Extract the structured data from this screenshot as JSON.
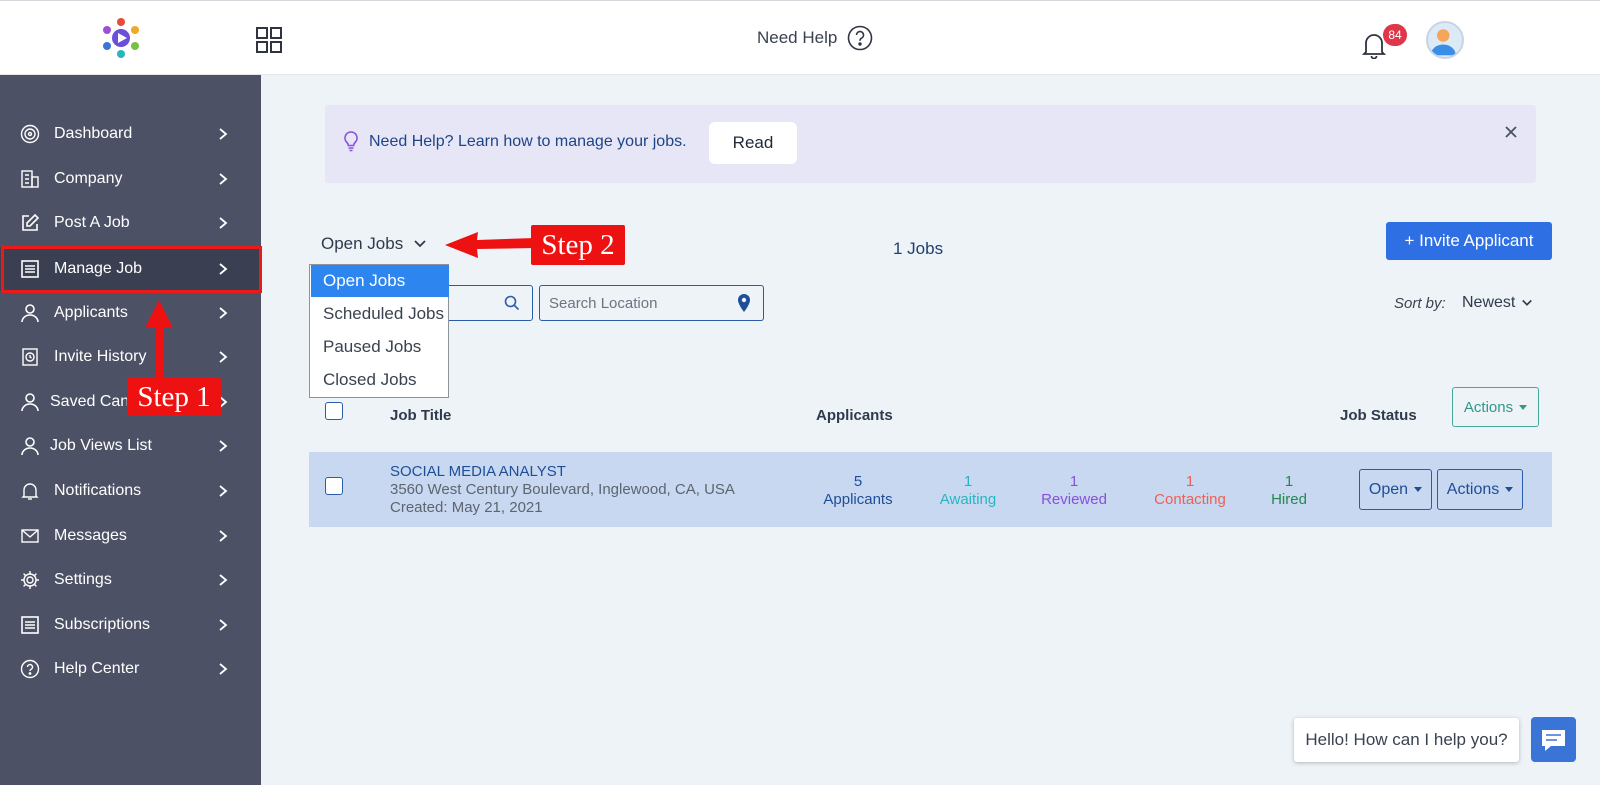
{
  "header": {
    "need_help": "Need Help",
    "notification_count": "84",
    "icons": [
      "logo-icon",
      "apps-grid-icon",
      "help-circle-icon",
      "bell-icon",
      "user-avatar-icon"
    ]
  },
  "sidebar": {
    "items": [
      {
        "label": "Dashboard",
        "icon": "target-icon"
      },
      {
        "label": "Company",
        "icon": "building-icon"
      },
      {
        "label": "Post A Job",
        "icon": "edit-icon"
      },
      {
        "label": "Manage Job",
        "icon": "list-icon"
      },
      {
        "label": "Applicants",
        "icon": "user-icon"
      },
      {
        "label": "Invite History",
        "icon": "history-icon"
      },
      {
        "label": "Saved Cand",
        "icon": "user-icon"
      },
      {
        "label": "Job Views List",
        "icon": "user-icon"
      },
      {
        "label": "Notifications",
        "icon": "bell-icon"
      },
      {
        "label": "Messages",
        "icon": "mail-icon"
      },
      {
        "label": "Settings",
        "icon": "gear-icon"
      },
      {
        "label": "Subscriptions",
        "icon": "list-icon"
      },
      {
        "label": "Help Center",
        "icon": "help-icon"
      }
    ]
  },
  "banner": {
    "text": "Need Help? Learn how to manage your jobs.",
    "read_label": "Read"
  },
  "jobs": {
    "selected_filter": "Open Jobs",
    "count_label": "1 Jobs",
    "invite_label": "+ Invite Applicant",
    "filter_options": [
      "Open Jobs",
      "Scheduled Jobs",
      "Paused Jobs",
      "Closed Jobs"
    ],
    "search_location_placeholder": "Search Location",
    "sort_label": "Sort by:",
    "sort_value": "Newest"
  },
  "table": {
    "headers": {
      "job_title": "Job Title",
      "applicants": "Applicants",
      "job_status": "Job Status",
      "actions": "Actions"
    },
    "rows": [
      {
        "title": "SOCIAL MEDIA ANALYST",
        "address": "3560 West Century Boulevard, Inglewood, CA, USA",
        "created": "Created: May 21, 2021",
        "stats": [
          {
            "count": "5",
            "label": "Applicants",
            "color": "#1e4e97"
          },
          {
            "count": "1",
            "label": "Awaiting",
            "color": "#27b6c0"
          },
          {
            "count": "1",
            "label": "Reviewed",
            "color": "#8a4fdc"
          },
          {
            "count": "1",
            "label": "Contacting",
            "color": "#ef5f52"
          },
          {
            "count": "1",
            "label": "Hired",
            "color": "#1f8a4d"
          }
        ],
        "status_button": "Open",
        "actions_button": "Actions"
      }
    ]
  },
  "chat": {
    "greeting": "Hello! How can I help you?"
  },
  "annotations": {
    "step1": "Step 1",
    "step2": "Step 2",
    "color": "#ee1111"
  }
}
